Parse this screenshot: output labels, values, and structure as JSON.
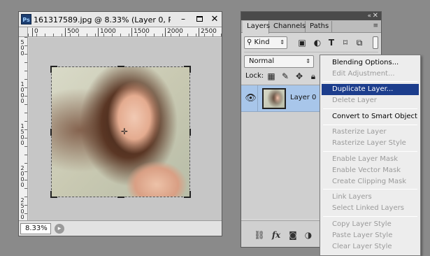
{
  "document": {
    "badge": "Ps",
    "title": "161317589.jpg @ 8.33% (Layer 0, R...",
    "minimize": "–",
    "close": "✕",
    "ruler_h_labels": [
      "0",
      "500",
      "1000",
      "1500",
      "2000",
      "2500"
    ],
    "ruler_v_labels": [
      "5 0 0",
      "1 0 0 0",
      "1 5 0 0",
      "2 0 0 0",
      "2 5 0 0"
    ],
    "zoom": "8.33%"
  },
  "layers_panel": {
    "collapse": "«",
    "close": "✕",
    "tabs": [
      "Layers",
      "Channels",
      "Paths"
    ],
    "filter_kind": "Kind",
    "blend_mode": "Normal",
    "lock_label": "Lock:",
    "layer": {
      "name": "Layer 0"
    },
    "icons": {
      "image_filter": "image-icon",
      "adjustment_filter": "adjustment-icon",
      "type_filter": "type-icon",
      "shape_filter": "shape-icon",
      "smart_filter": "smart-object-icon",
      "lock_pixels": "checkerboard-icon",
      "lock_paint": "brush-icon",
      "lock_move": "move-icon",
      "lock_all": "lock-icon",
      "link": "link-icon",
      "fx": "fx-icon",
      "mask": "mask-icon",
      "adjust": "half-circle-icon"
    },
    "footer_fx": "fx"
  },
  "context_menu": {
    "groups": [
      [
        {
          "label": "Blending Options...",
          "enabled": true
        },
        {
          "label": "Edit Adjustment...",
          "enabled": false
        }
      ],
      [
        {
          "label": "Duplicate Layer...",
          "enabled": true,
          "highlighted": true
        },
        {
          "label": "Delete Layer",
          "enabled": false
        }
      ],
      [
        {
          "label": "Convert to Smart Object",
          "enabled": true
        }
      ],
      [
        {
          "label": "Rasterize Layer",
          "enabled": false
        },
        {
          "label": "Rasterize Layer Style",
          "enabled": false
        }
      ],
      [
        {
          "label": "Enable Layer Mask",
          "enabled": false
        },
        {
          "label": "Enable Vector Mask",
          "enabled": false
        },
        {
          "label": "Create Clipping Mask",
          "enabled": false
        }
      ],
      [
        {
          "label": "Link Layers",
          "enabled": false
        },
        {
          "label": "Select Linked Layers",
          "enabled": false
        }
      ],
      [
        {
          "label": "Copy Layer Style",
          "enabled": false
        },
        {
          "label": "Paste Layer Style",
          "enabled": false
        },
        {
          "label": "Clear Layer Style",
          "enabled": false
        }
      ]
    ]
  }
}
